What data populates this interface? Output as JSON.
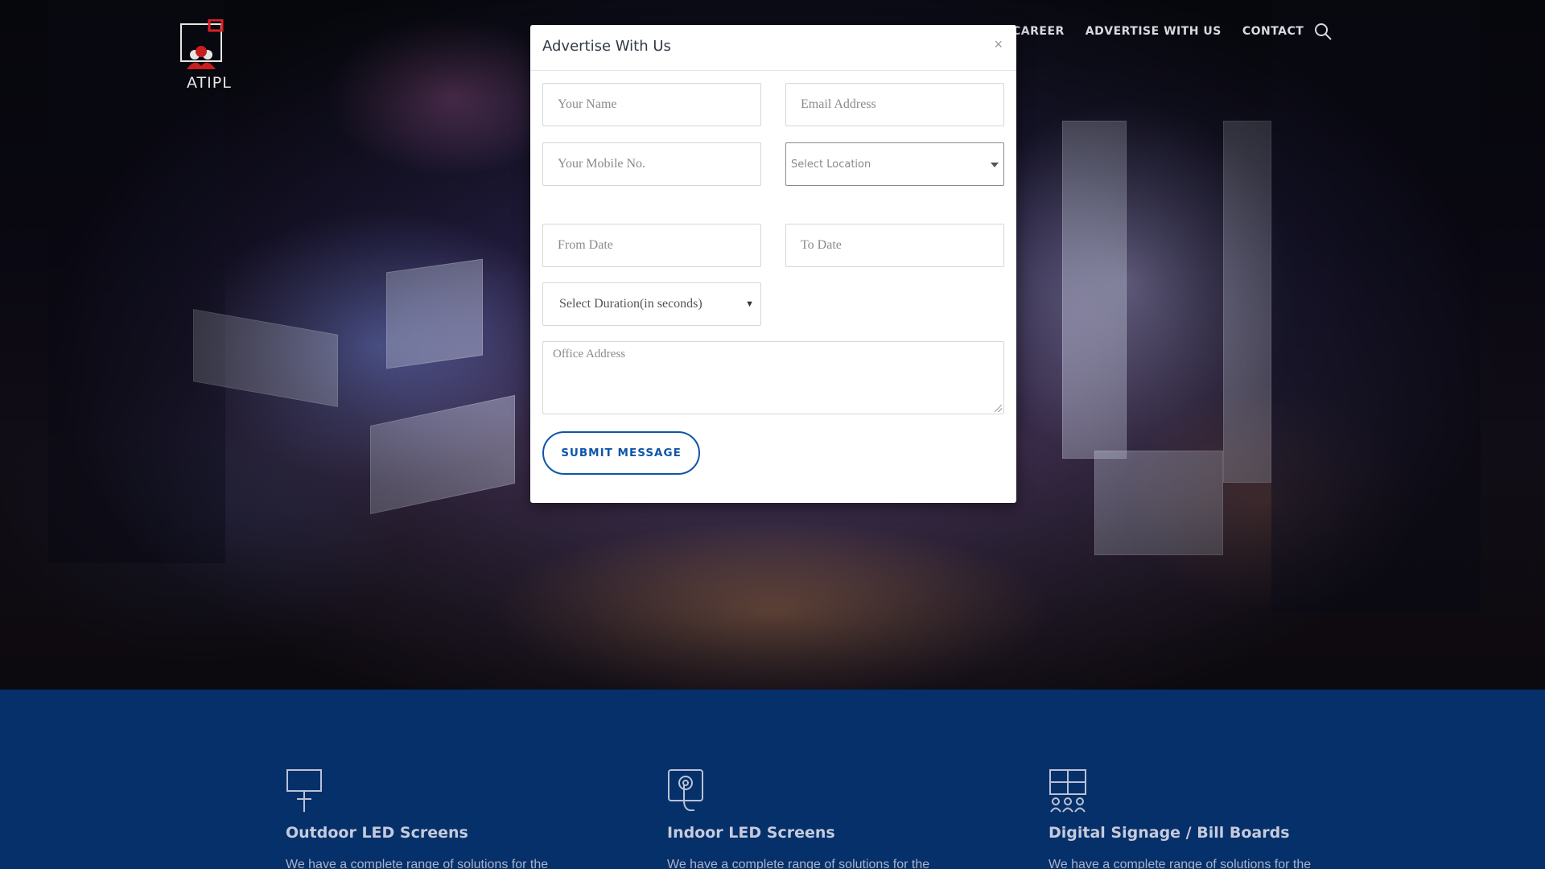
{
  "brand": {
    "logo_text": "ATIPL"
  },
  "nav": {
    "items": [
      "CAREER",
      "ADVERTISE WITH US",
      "CONTACT"
    ]
  },
  "modal": {
    "title": "Advertise With Us",
    "close_label": "×",
    "fields": {
      "name_placeholder": "Your Name",
      "email_placeholder": "Email Address",
      "mobile_placeholder": "Your Mobile No.",
      "location_selected": "Select Location",
      "from_date_placeholder": "From Date",
      "to_date_placeholder": "To Date",
      "duration_selected": "Select Duration(in seconds)",
      "address_placeholder": "Office Address"
    },
    "submit_label": "SUBMIT MESSAGE"
  },
  "services": [
    {
      "title": "Outdoor LED Screens",
      "text": "We have a complete range of solutions for the"
    },
    {
      "title": "Indoor LED Screens",
      "text": "We have a complete range of solutions for the"
    },
    {
      "title": "Digital Signage / Bill Boards",
      "text": "We have a complete range of solutions for the"
    }
  ],
  "colors": {
    "accent": "#0f56a8",
    "services_bg": "#06306a"
  }
}
